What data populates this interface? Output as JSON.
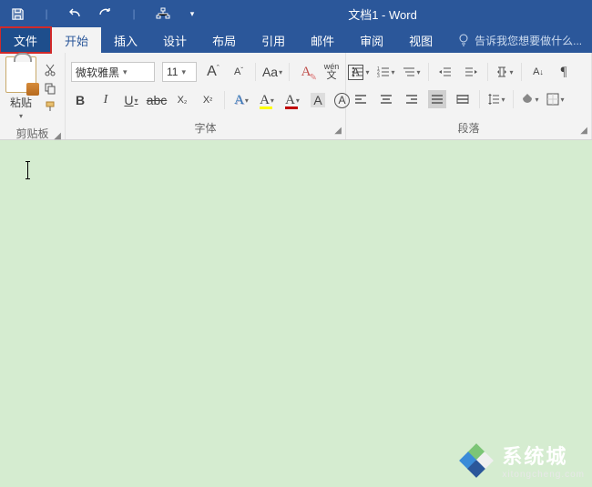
{
  "title": "文档1 - Word",
  "qat": {
    "save": "save",
    "undo": "undo",
    "redo": "redo",
    "org": "org-chart"
  },
  "tabs": {
    "file": "文件",
    "home": "开始",
    "insert": "插入",
    "design": "设计",
    "layout": "布局",
    "references": "引用",
    "mailings": "邮件",
    "review": "审阅",
    "view": "视图"
  },
  "tellme": "告诉我您想要做什么...",
  "groups": {
    "clipboard": "剪贴板",
    "font": "字体",
    "paragraph": "段落"
  },
  "clipboard": {
    "paste": "粘贴"
  },
  "font": {
    "name": "微软雅黑",
    "size": "11"
  },
  "watermark": {
    "main": "系统城",
    "sub": "xitongcheng.com"
  },
  "glyph": {
    "incFont": "A",
    "decFont": "A",
    "caseAa": "Aa",
    "clearFmt": "A",
    "phonetic": "wén",
    "charBorder": "A",
    "bold": "B",
    "italic": "I",
    "underline": "U",
    "strike": "abc",
    "subscript": "X",
    "superscript": "X",
    "textfx": "A",
    "highlight": "A",
    "fontcolor": "A",
    "charshade": "A",
    "boxedA": "A",
    "bullets": "•",
    "numbering": "1",
    "multilevel": "≡",
    "indentL": "◀",
    "indentR": "▶",
    "sortAZ": "A↓",
    "showmarks": "¶",
    "alignL": "≡",
    "alignC": "≡",
    "alignR": "≡",
    "alignJ": "≡",
    "linespace": "↕",
    "shading": "▢",
    "borders": "▦"
  }
}
